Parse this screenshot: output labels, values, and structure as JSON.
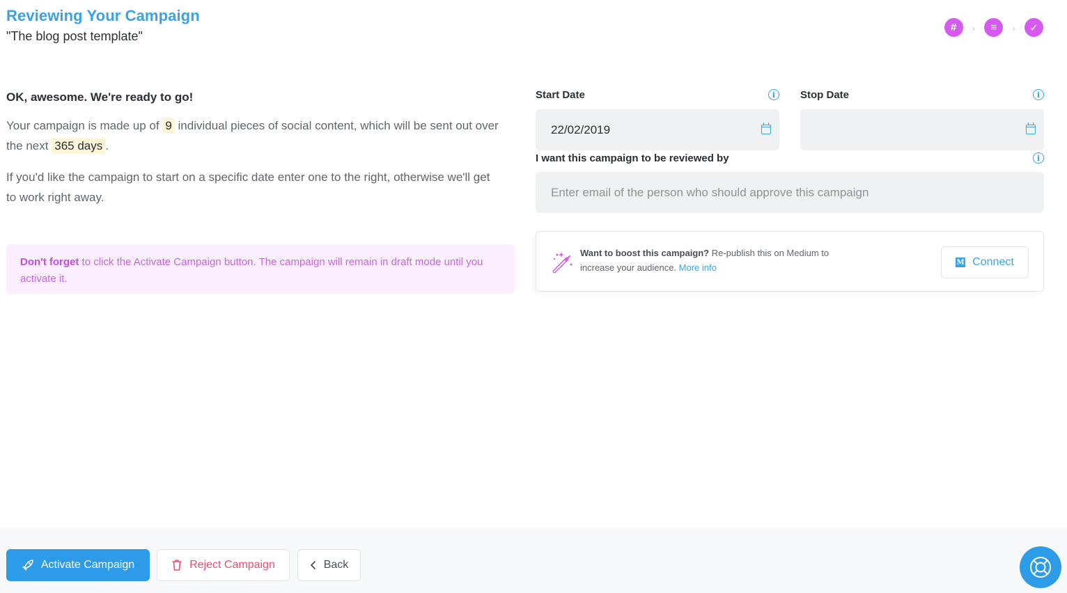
{
  "header": {
    "title": "Reviewing Your Campaign",
    "subtitle": "\"The blog post template\""
  },
  "steps": [
    {
      "icon": "hash-icon",
      "glyph": "#"
    },
    {
      "icon": "list-icon",
      "glyph": "≡"
    },
    {
      "icon": "check-icon",
      "glyph": "✓"
    }
  ],
  "intro": {
    "heading": "OK, awesome. We're ready to go!",
    "made_up_prefix": "Your campaign is made up of",
    "pieces_count": "9",
    "made_up_middle": "individual pieces of social content, which will be sent out over the next",
    "duration": "365 days",
    "made_up_suffix": ".",
    "start_info": "If you'd like the campaign to start on a specific date enter one to the right, otherwise we'll get to work right away."
  },
  "notice": {
    "strong": "Don't forget",
    "text": " to click the Activate Campaign button. The campaign will remain in draft mode until you activate it."
  },
  "dates": {
    "start_label": "Start Date",
    "start_value": "22/02/2019",
    "stop_label": "Stop Date",
    "stop_value": ""
  },
  "review": {
    "label": "I want this campaign to be reviewed by",
    "placeholder": "Enter email of the person who should approve this campaign"
  },
  "boost": {
    "title": "Want to boost this campaign?",
    "text": " Re-publish this on Medium to increase your audience. ",
    "more_info": "More info",
    "connect_label": "Connect",
    "medium_glyph": "M"
  },
  "footer": {
    "activate_label": "Activate Campaign",
    "reject_label": "Reject Campaign",
    "back_label": "Back"
  },
  "colors": {
    "accent": "#3aa3e3",
    "primary_button": "#2e9be8",
    "step_purple": "#d45af0",
    "reject_red": "#ee4d6c",
    "notice_bg": "#fbeefe"
  }
}
